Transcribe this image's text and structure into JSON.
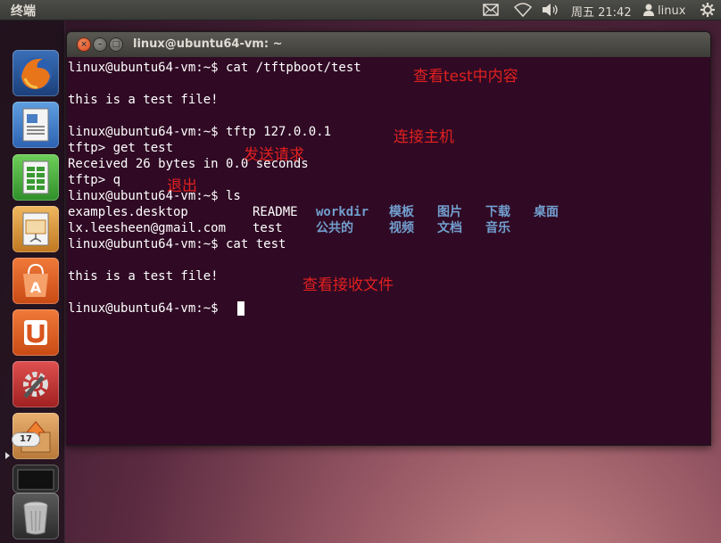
{
  "top_panel": {
    "app_title": "终端",
    "clock": "周五 21:42",
    "user": "linux",
    "icons": [
      "mail-icon",
      "wifi-icon",
      "sound-icon",
      "user-icon",
      "power-icon"
    ]
  },
  "launcher": {
    "items": [
      {
        "name": "firefox-icon"
      },
      {
        "name": "writer-icon"
      },
      {
        "name": "calc-icon"
      },
      {
        "name": "impress-icon"
      },
      {
        "name": "software-center-icon"
      },
      {
        "name": "ubuntu-one-icon"
      },
      {
        "name": "system-settings-icon"
      },
      {
        "name": "update-manager-icon"
      },
      {
        "name": "terminal-icon"
      },
      {
        "name": "trash-icon"
      }
    ],
    "badge": "17"
  },
  "window": {
    "title": "linux@ubuntu64-vm: ~"
  },
  "terminal": {
    "lines": [
      "linux@ubuntu64-vm:~$ cat /tftpboot/test",
      "",
      "this is a test file!",
      "",
      "linux@ubuntu64-vm:~$ tftp 127.0.0.1",
      "tftp> get test",
      "Received 26 bytes in 0.0 seconds",
      "tftp> q",
      "linux@ubuntu64-vm:~$ ls"
    ],
    "ls_row1": {
      "files": [
        "examples.desktop",
        "README"
      ],
      "dirs": [
        "workdir",
        "模板",
        "图片",
        "下载",
        "桌面"
      ]
    },
    "ls_row2": {
      "files": [
        "lx.leesheen@gmail.com",
        "test"
      ],
      "dirs": [
        "公共的",
        "视频",
        "文档",
        "音乐"
      ]
    },
    "lines_after": [
      "linux@ubuntu64-vm:~$ cat test",
      "",
      "this is a test file!",
      "",
      "linux@ubuntu64-vm:~$ "
    ],
    "annotations": [
      "查看test中内容",
      "连接主机",
      "发送请求",
      "退出",
      "查看接收文件"
    ]
  },
  "colors": {
    "terminal_bg": "#300a24",
    "directory": "#729fcf",
    "annotation": "#e02020"
  }
}
